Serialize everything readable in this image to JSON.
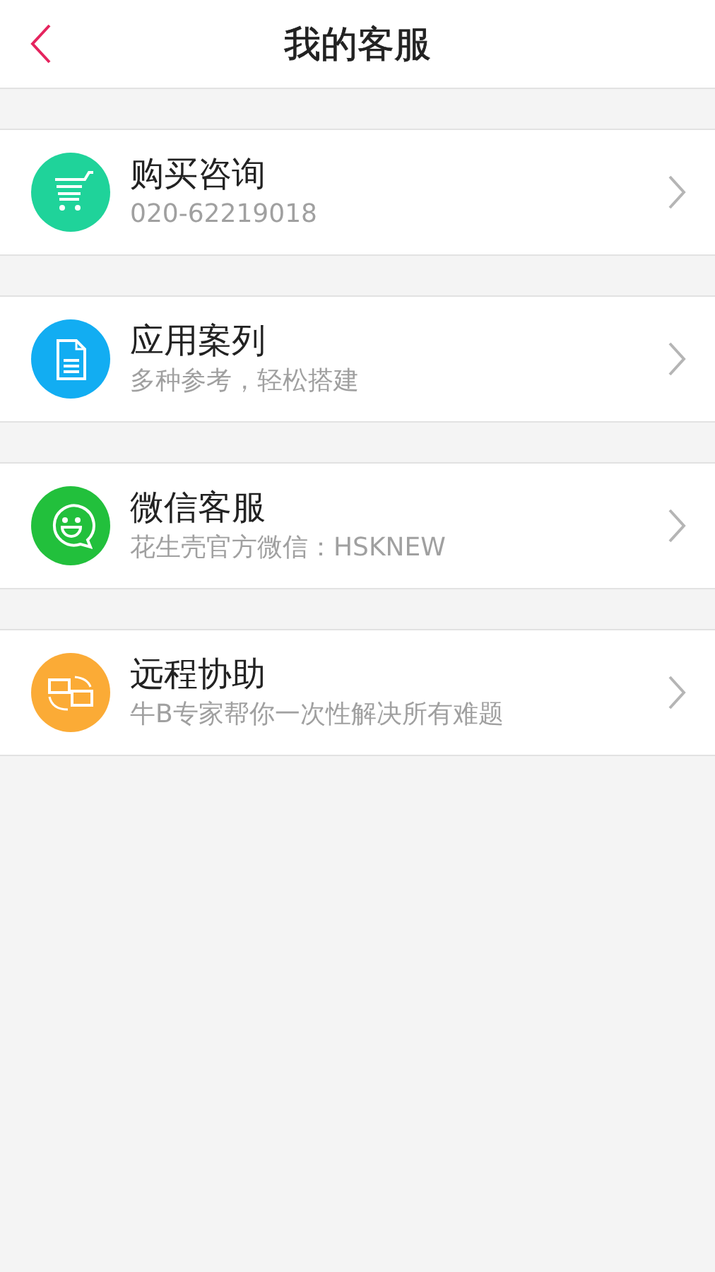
{
  "header": {
    "title": "我的客服"
  },
  "items": [
    {
      "kind": "cart",
      "color": "#1fd39a",
      "title": "购买咨询",
      "subtitle": "020-62219018"
    },
    {
      "kind": "document",
      "color": "#12adf2",
      "title": "应用案列",
      "subtitle": "多种参考，轻松搭建"
    },
    {
      "kind": "chat",
      "color": "#22c03c",
      "title": "微信客服",
      "subtitle": "花生壳官方微信：HSKNEW"
    },
    {
      "kind": "remote",
      "color": "#fbab36",
      "title": "远程协助",
      "subtitle": "牛B专家帮你一次性解决所有难题"
    }
  ]
}
